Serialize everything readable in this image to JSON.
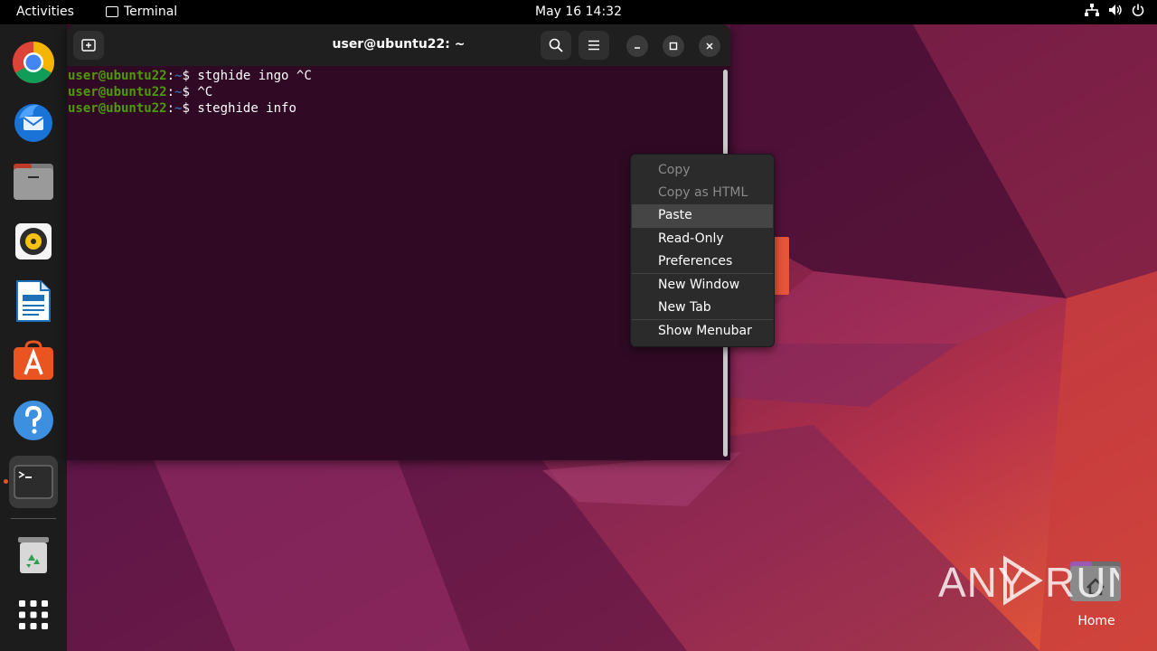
{
  "topbar": {
    "activities": "Activities",
    "app_name": "Terminal",
    "clock": "May 16  14:32"
  },
  "dock": {
    "items": [
      {
        "name": "chrome-icon"
      },
      {
        "name": "thunderbird-icon"
      },
      {
        "name": "files-icon"
      },
      {
        "name": "rhythmbox-icon"
      },
      {
        "name": "libreoffice-writer-icon"
      },
      {
        "name": "app-center-icon"
      },
      {
        "name": "help-icon"
      },
      {
        "name": "terminal-icon",
        "active": true
      },
      {
        "name": "trash-icon"
      },
      {
        "name": "show-apps-icon"
      }
    ]
  },
  "terminal": {
    "title": "user@ubuntu22: ~",
    "lines": [
      {
        "user": "user@ubuntu22",
        "sep": ":",
        "path": "~",
        "symbol": "$ ",
        "command": "stghide ingo ^C"
      },
      {
        "user": "user@ubuntu22",
        "sep": ":",
        "path": "~",
        "symbol": "$ ",
        "command": "^C"
      },
      {
        "user": "user@ubuntu22",
        "sep": ":",
        "path": "~",
        "symbol": "$ ",
        "command": "steghide info"
      }
    ]
  },
  "context_menu": {
    "items": [
      {
        "label": "Copy",
        "disabled": true
      },
      {
        "label": "Copy as HTML",
        "disabled": true
      },
      {
        "label": "Paste",
        "hover": true
      },
      {
        "label": "Read-Only"
      },
      {
        "label": "Preferences"
      },
      {
        "label": "New Window"
      },
      {
        "label": "New Tab"
      },
      {
        "label": "Show Menubar"
      }
    ]
  },
  "desktop": {
    "home_label": "Home",
    "watermark": "ANY RUN"
  },
  "colors": {
    "accent": "#e95420",
    "terminal_bg": "#300a24",
    "prompt_user": "#4e9a06",
    "prompt_path": "#3465a4"
  }
}
